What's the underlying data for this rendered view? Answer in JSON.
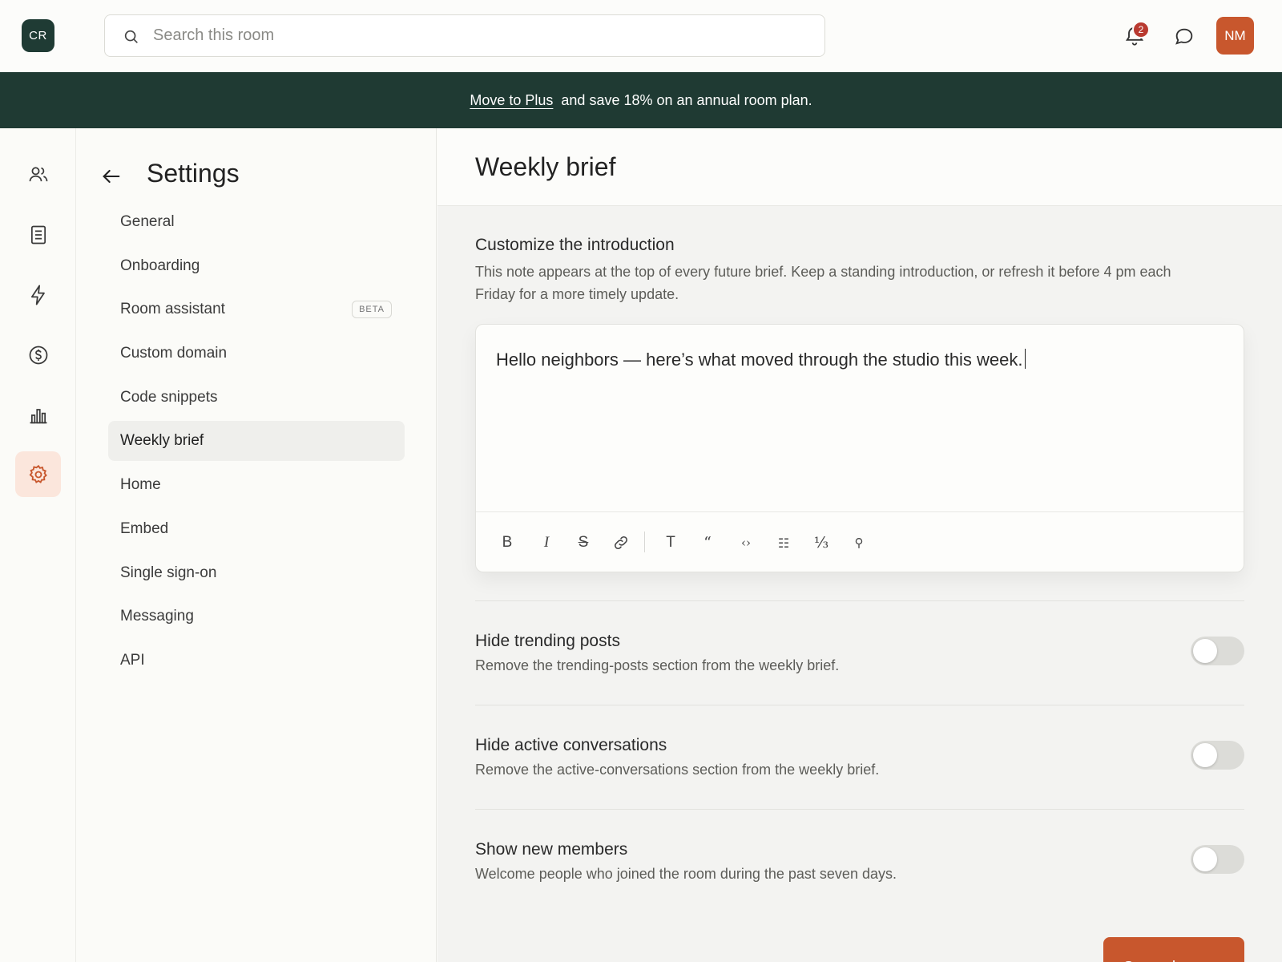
{
  "app": {
    "logo_text": "CR"
  },
  "search": {
    "placeholder": "Search this room"
  },
  "notifications": {
    "count": "2"
  },
  "user": {
    "initials": "NM"
  },
  "banner": {
    "link_text": "Move to Plus",
    "text": "and save 18% on an annual room plan."
  },
  "rail": {
    "items": [
      {
        "icon": "members-icon"
      },
      {
        "icon": "document-icon"
      },
      {
        "icon": "lightning-icon"
      },
      {
        "icon": "dollar-icon"
      },
      {
        "icon": "analytics-icon"
      },
      {
        "icon": "settings-gear-icon",
        "active": true
      }
    ]
  },
  "settings_nav": {
    "title": "Settings",
    "items": [
      {
        "label": "General"
      },
      {
        "label": "Onboarding"
      },
      {
        "label": "Room assistant",
        "badge": "BETA"
      },
      {
        "label": "Custom domain"
      },
      {
        "label": "Code snippets"
      },
      {
        "label": "Weekly brief",
        "active": true
      },
      {
        "label": "Home"
      },
      {
        "label": "Embed"
      },
      {
        "label": "Single sign-on"
      },
      {
        "label": "Messaging"
      },
      {
        "label": "API"
      }
    ]
  },
  "main": {
    "title": "Weekly brief",
    "intro": {
      "label": "Customize the introduction",
      "description": "This note appears at the top of every future brief. Keep a standing introduction, or refresh it before 4 pm each Friday for a more timely update.",
      "editor_text": "Hello neighbors — here’s what moved through the studio this week."
    },
    "toolbar": {
      "bold": "B",
      "italic": "I",
      "strike": "S",
      "text": "T",
      "quote": "“",
      "code": "‹›",
      "list": "☷",
      "fraction": "⅓",
      "key": "⚲"
    },
    "options": [
      {
        "title": "Hide trending posts",
        "description": "Remove the trending-posts section from the weekly brief.",
        "enabled": false
      },
      {
        "title": "Hide active conversations",
        "description": "Remove the active-conversations section from the weekly brief.",
        "enabled": false
      },
      {
        "title": "Show new members",
        "description": "Welcome people who joined the room during the past seven days.",
        "enabled": false
      }
    ],
    "save_label": "Save changes"
  },
  "colors": {
    "accent": "#c8572d",
    "banner": "#1f3a33",
    "badge": "#b93a30"
  }
}
